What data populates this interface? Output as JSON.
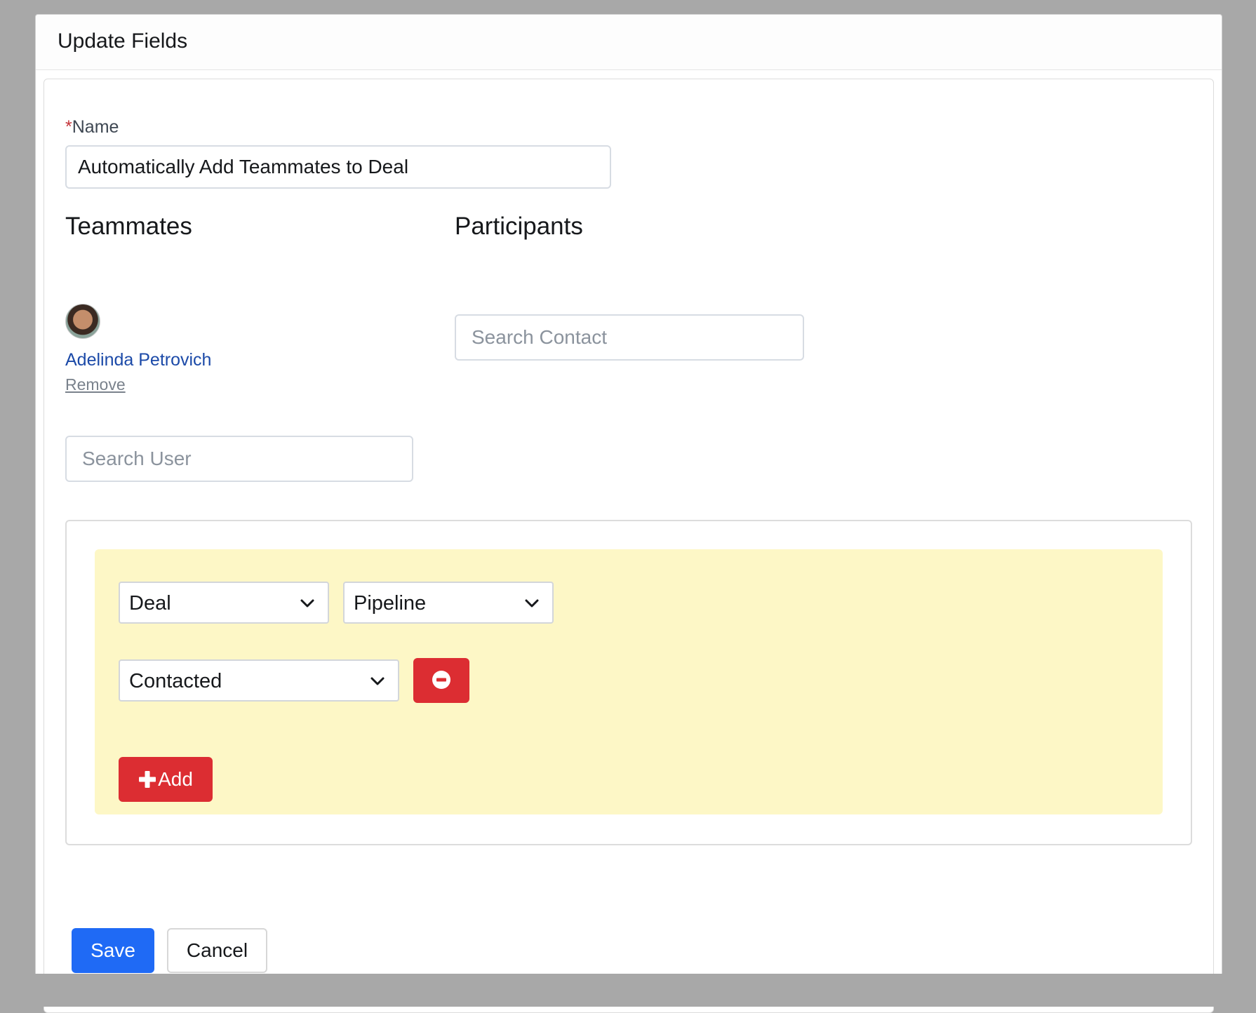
{
  "modal": {
    "title": "Update Fields"
  },
  "name_field": {
    "required_mark": "*",
    "label": "Name",
    "value": "Automatically Add Teammates to Deal"
  },
  "teammates": {
    "title": "Teammates",
    "members": [
      {
        "name": "Adelinda Petrovich",
        "remove_label": "Remove"
      }
    ],
    "search": {
      "placeholder": "Search User"
    }
  },
  "participants": {
    "title": "Participants",
    "search": {
      "placeholder": "Search Contact"
    }
  },
  "rule_group": {
    "background_color": "#fdf7c6",
    "entity_select": "Deal",
    "field_select": "Pipeline",
    "value_select": "Contacted",
    "remove_icon": "minus-circle-icon",
    "add_label": "Add",
    "add_icon": "plus-icon"
  },
  "actions": {
    "save_label": "Save",
    "cancel_label": "Cancel"
  },
  "colors": {
    "primary": "#1f6af5",
    "danger": "#dc2d32",
    "link": "#1c4aa8"
  }
}
